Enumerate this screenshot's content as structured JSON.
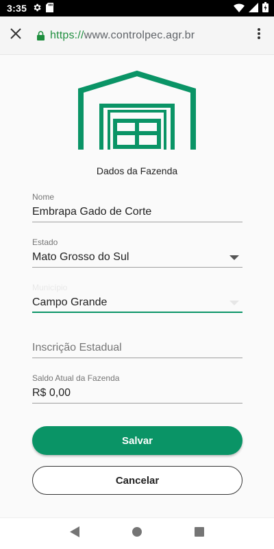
{
  "status_bar": {
    "time": "3:35",
    "icons_left": [
      "gear-icon",
      "sd-card-icon"
    ],
    "icons_right": [
      "wifi-icon",
      "cellular-icon",
      "battery-icon"
    ]
  },
  "browser": {
    "url_scheme": "https://",
    "url_host": "www.controlpec.agr.br",
    "close_icon": "close-icon",
    "lock_icon": "lock-icon",
    "menu_icon": "more-vert-icon"
  },
  "page": {
    "subtitle": "Dados da Fazenda",
    "logo_icon": "barn-icon",
    "accent_color": "#0a9466"
  },
  "form": {
    "nome": {
      "label": "Nome",
      "value": "Embrapa Gado de Corte"
    },
    "estado": {
      "label": "Estado",
      "value": "Mato Grosso do Sul"
    },
    "municipio": {
      "label": "Município",
      "value": "Campo Grande"
    },
    "inscricao": {
      "placeholder": "Inscrição Estadual"
    },
    "saldo": {
      "label": "Saldo Atual da Fazenda",
      "value": "R$ 0,00"
    }
  },
  "actions": {
    "save_label": "Salvar",
    "cancel_label": "Cancelar"
  },
  "nav": {
    "back_icon": "back-triangle-icon",
    "home_icon": "home-circle-icon",
    "recents_icon": "recents-square-icon"
  }
}
